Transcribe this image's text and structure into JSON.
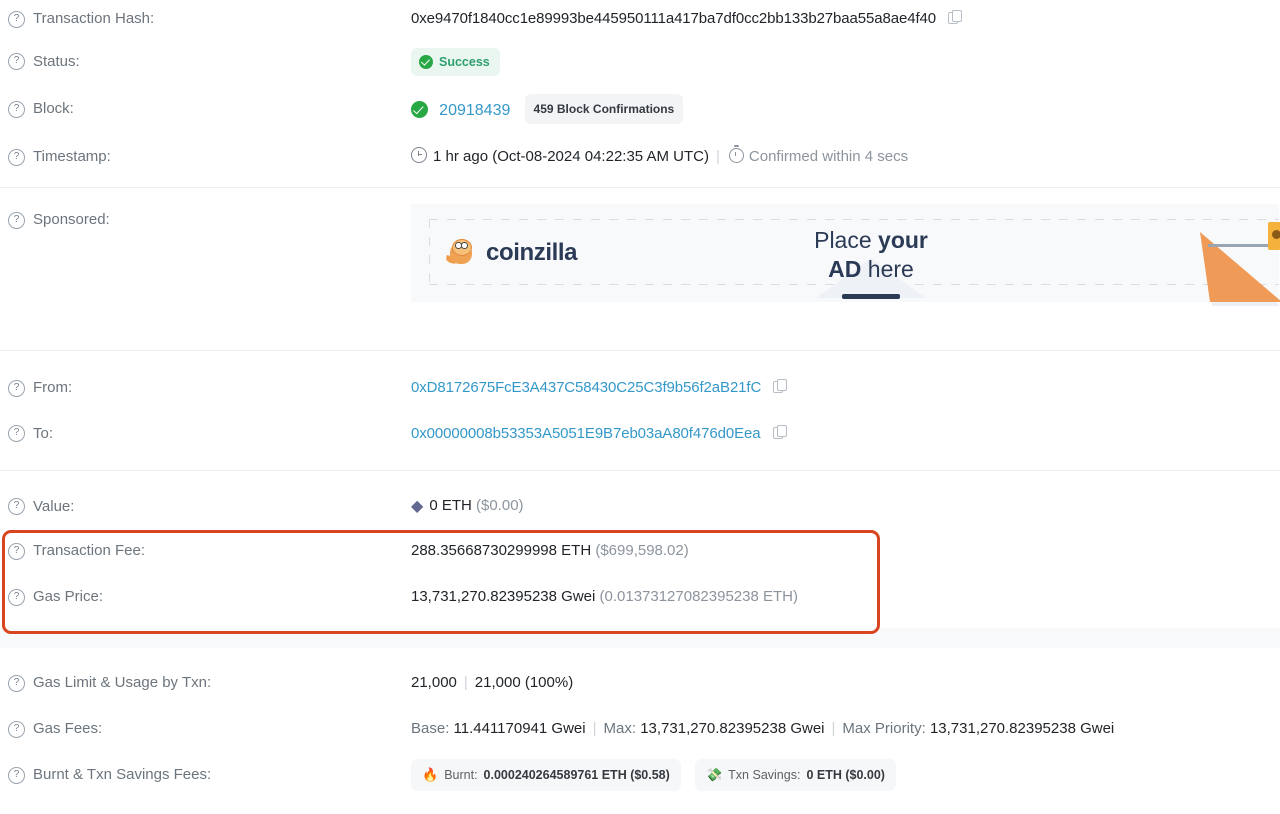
{
  "rows": {
    "transaction_hash": {
      "label": "Transaction Hash:",
      "value": "0xe9470f1840cc1e89993be445950111a417ba7df0cc2bb133b27baa55a8ae4f40"
    },
    "status": {
      "label": "Status:",
      "value": "Success"
    },
    "block": {
      "label": "Block:",
      "number": "20918439",
      "confirmations": "459 Block Confirmations"
    },
    "timestamp": {
      "label": "Timestamp:",
      "relative": "1 hr ago (Oct-08-2024 04:22:35 AM UTC)",
      "separator": "|",
      "confirmed": "Confirmed within 4 secs"
    },
    "sponsored": {
      "label": "Sponsored:",
      "brand": "coinzilla",
      "ad_line1_light": "Place ",
      "ad_line1_bold": "your",
      "ad_line2_bold": "AD",
      "ad_line2_light": " here"
    },
    "from": {
      "label": "From:",
      "value": "0xD8172675FcE3A437C58430C25C3f9b56f2aB21fC"
    },
    "to": {
      "label": "To:",
      "value": "0x00000008b53353A5051E9B7eb03aA80f476d0Eea"
    },
    "value": {
      "label": "Value:",
      "eth": "0 ETH",
      "usd": "($0.00)"
    },
    "transaction_fee": {
      "label": "Transaction Fee:",
      "eth": "288.35668730299998 ETH",
      "usd": "($699,598.02)"
    },
    "gas_price": {
      "label": "Gas Price:",
      "gwei": "13,731,270.82395238 Gwei",
      "eth": "(0.01373127082395238 ETH)"
    },
    "gas_limit": {
      "label": "Gas Limit & Usage by Txn:",
      "limit": "21,000",
      "separator": "|",
      "usage": "21,000 (100%)"
    },
    "gas_fees": {
      "label": "Gas Fees:",
      "base_key": "Base:",
      "base_value": "11.441170941 Gwei",
      "sep1": "|",
      "max_key": "Max:",
      "max_value": "13,731,270.82395238 Gwei",
      "sep2": "|",
      "max_priority_key": "Max Priority:",
      "max_priority_value": "13,731,270.82395238 Gwei"
    },
    "burnt_savings": {
      "label": "Burnt & Txn Savings Fees:",
      "burnt_key": "Burnt:",
      "burnt_value": "0.000240264589761 ETH ($0.58)",
      "savings_key": "Txn Savings:",
      "savings_value": "0 ETH ($0.00)"
    }
  },
  "icons": {
    "help": "?",
    "burnt": "🔥",
    "savings": "💸"
  },
  "colors": {
    "link": "#3498c9",
    "success": "#28a745",
    "highlight": "#d9451f",
    "muted": "#8c949d"
  }
}
